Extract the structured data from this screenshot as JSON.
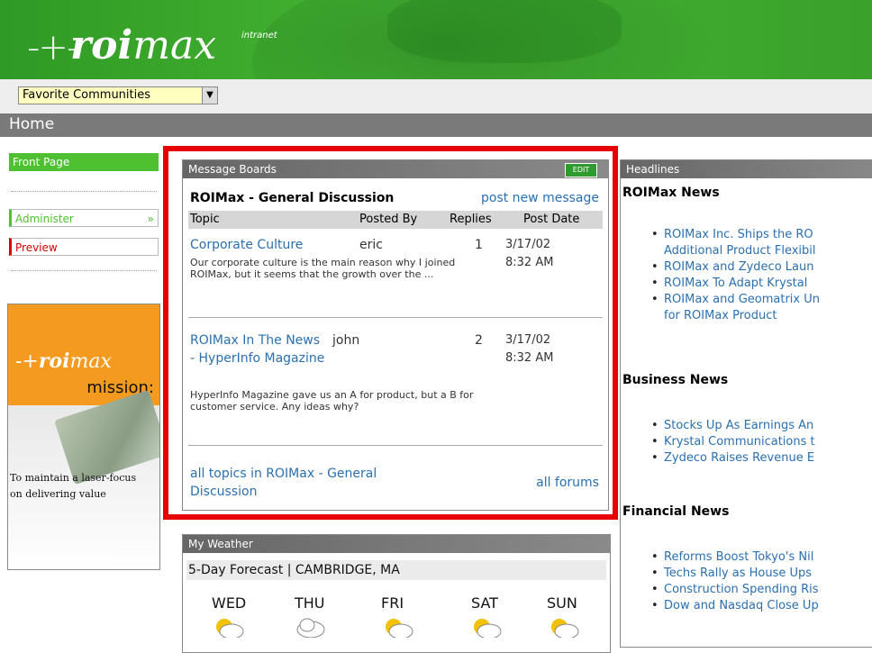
{
  "header": {
    "logo_mark": "-+-",
    "logo_bold": "roi",
    "logo_light": "max",
    "logo_sup": "intranet"
  },
  "favorites": {
    "selected": "Favorite Communities"
  },
  "home_bar": {
    "title": "Home"
  },
  "sidebar": {
    "front_page": "Front Page",
    "administer": "Administer",
    "administer_arrow": "»",
    "preview": "Preview"
  },
  "mission_ad": {
    "logo_bold": "roi",
    "logo_light": "max",
    "word": "mission:",
    "line1": "To maintain a laser-focus",
    "line2": "on delivering value"
  },
  "message_boards": {
    "panel_title": "Message Boards",
    "edit": "EDIT",
    "board_title": "ROIMax - General Discussion",
    "post_new": "post new message",
    "columns": {
      "topic": "Topic",
      "posted_by": "Posted By",
      "replies": "Replies",
      "post_date": "Post Date"
    },
    "rows": [
      {
        "topic": "Corporate Culture",
        "author": "eric",
        "replies": "1",
        "date": "3/17/02 8:32 AM",
        "excerpt": "Our corporate culture is the main reason why I joined ROIMax, but it seems that the growth over the ..."
      },
      {
        "topic": "ROIMax In The News - HyperInfo Magazine",
        "author": "john",
        "replies": "2",
        "date": "3/17/02 8:32 AM",
        "excerpt": "HyperInfo Magazine gave us an A for product, but a B for customer service. Any ideas why?"
      }
    ],
    "all_topics": "all topics in ROIMax - General Discussion",
    "all_forums": "all forums"
  },
  "headlines": {
    "panel_title": "Headlines",
    "sections": [
      {
        "title": "ROIMax News",
        "items": [
          "ROIMax Inc. Ships the RO",
          "Additional Product Flexibil",
          "ROIMax and Zydeco Laun",
          "ROIMax To Adapt Krystal",
          "ROIMax and Geomatrix Un",
          "for ROIMax Product"
        ]
      },
      {
        "title": "Business News",
        "items": [
          "Stocks Up As Earnings An",
          "Krystal Communications t",
          "Zydeco Raises Revenue E"
        ]
      },
      {
        "title": "Financial News",
        "items": [
          "Reforms Boost Tokyo's Nil",
          "Techs Rally as House Ups",
          "Construction Spending Ris",
          "Dow and Nasdaq Close Up"
        ]
      }
    ]
  },
  "weather": {
    "panel_title": "My Weather",
    "forecast": "5-Day Forecast | CAMBRIDGE, MA",
    "days": [
      "WED",
      "THU",
      "FRI",
      "SAT",
      "SUN"
    ],
    "icons": [
      "sun-cloud-icon",
      "cloud-icon",
      "sun-cloud-icon",
      "sun-cloud-icon",
      "sun-cloud-icon"
    ]
  }
}
